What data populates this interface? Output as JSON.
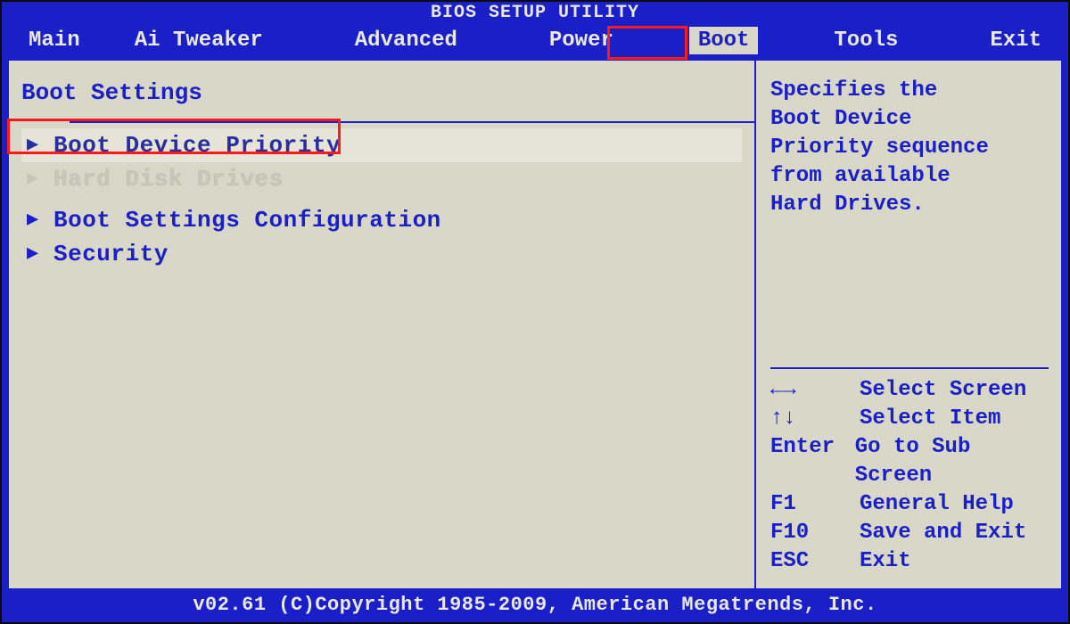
{
  "title": "BIOS SETUP UTILITY",
  "tabs": {
    "main": "Main",
    "ai": "Ai Tweaker",
    "adv": "Advanced",
    "power": "Power",
    "boot": "Boot",
    "tools": "Tools",
    "exit": "Exit"
  },
  "section_title": "Boot Settings",
  "menu": {
    "boot_device_priority": "Boot Device Priority",
    "hard_disk_drives": "Hard Disk Drives",
    "boot_settings_config": "Boot Settings Configuration",
    "security": "Security"
  },
  "help": {
    "l1": "Specifies the",
    "l2": "Boot Device",
    "l3": "Priority sequence",
    "l4": "from available",
    "l5": "Hard Drives."
  },
  "keys": {
    "lr": {
      "k": "←→",
      "d": "Select Screen"
    },
    "ud": {
      "k": "↑↓",
      "d": "Select Item"
    },
    "enter": {
      "k": "Enter",
      "d": "Go to Sub Screen"
    },
    "f1": {
      "k": "F1",
      "d": "General Help"
    },
    "f10": {
      "k": "F10",
      "d": "Save and Exit"
    },
    "esc": {
      "k": "ESC",
      "d": "Exit"
    }
  },
  "footer": "v02.61 (C)Copyright 1985-2009, American Megatrends, Inc."
}
